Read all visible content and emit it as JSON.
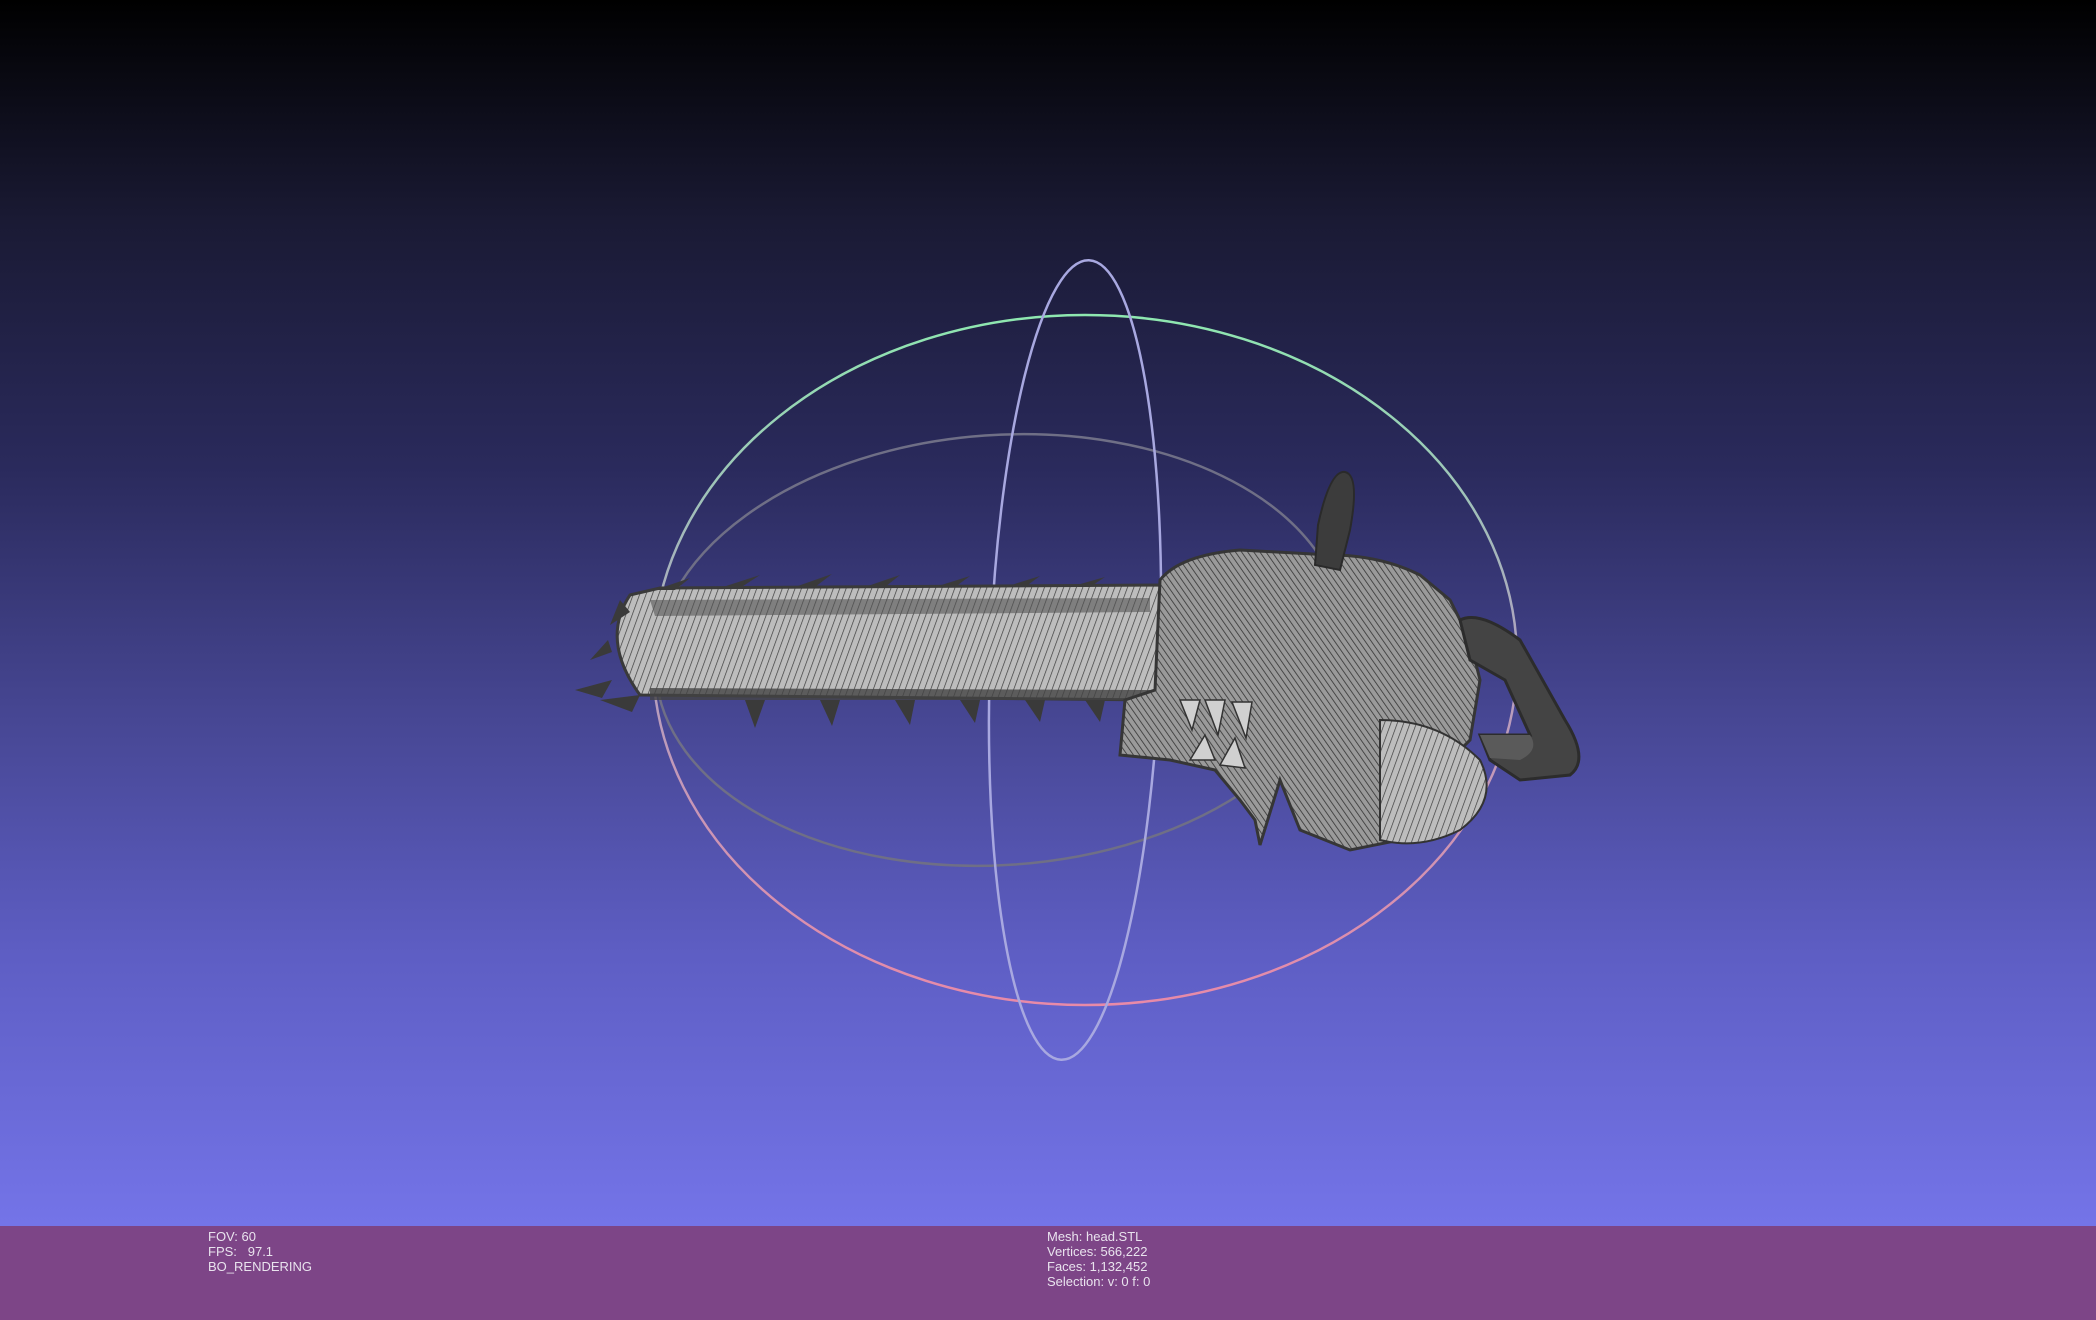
{
  "viewer": {
    "left_info": {
      "fov": "FOV: 60",
      "fps": "FPS:   97.1",
      "mode": "BO_RENDERING"
    },
    "mesh_info": {
      "mesh": "Mesh: head.STL",
      "vertices": "Vertices: 566,222",
      "faces": "Faces: 1,132,452",
      "selection": "Selection: v: 0 f: 0"
    }
  },
  "colors": {
    "statusbar_bg": "#7d4587",
    "trackball_x": "#e88aa8",
    "trackball_y": "#8ee8b0",
    "trackball_z": "#b8b8f0",
    "mesh": "#4a4a4a"
  }
}
